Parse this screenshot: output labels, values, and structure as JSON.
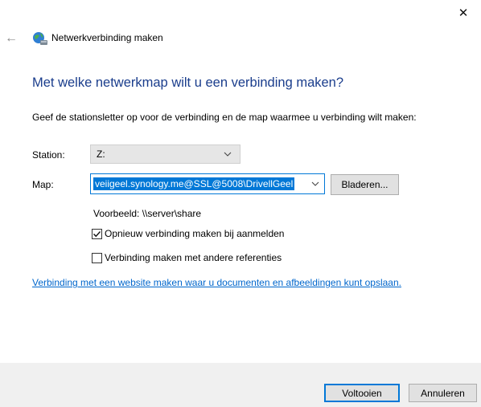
{
  "window": {
    "close_glyph": "✕",
    "back_glyph": "←",
    "title": "Netwerkverbinding maken"
  },
  "main": {
    "heading": "Met welke netwerkmap wilt u een verbinding maken?",
    "instruction": "Geef de stationsletter op voor de verbinding en de map waarmee u verbinding wilt maken:",
    "station_label": "Station:",
    "station_value": "Z:",
    "map_label": "Map:",
    "map_value": "veiigeel.synology.me@SSL@5008\\DrivellGeel",
    "browse_label": "Bladeren...",
    "example_text": "Voorbeeld: \\\\server\\share",
    "checkboxes": [
      {
        "label": "Opnieuw verbinding maken bij aanmelden",
        "checked": true
      },
      {
        "label": "Verbinding maken met andere referenties",
        "checked": false
      }
    ],
    "website_link": "Verbinding met een website maken waar u documenten en afbeeldingen kunt opslaan."
  },
  "footer": {
    "finish_label": "Voltooien",
    "cancel_label": "Annuleren"
  },
  "colors": {
    "heading": "#1a3d8c",
    "accent": "#0078d7",
    "link": "#0066cc",
    "footer_bg": "#f0f0f0"
  },
  "icons": [
    "close-icon",
    "back-arrow-icon",
    "network-drive-icon",
    "chevron-down-icon",
    "checkmark-icon"
  ]
}
